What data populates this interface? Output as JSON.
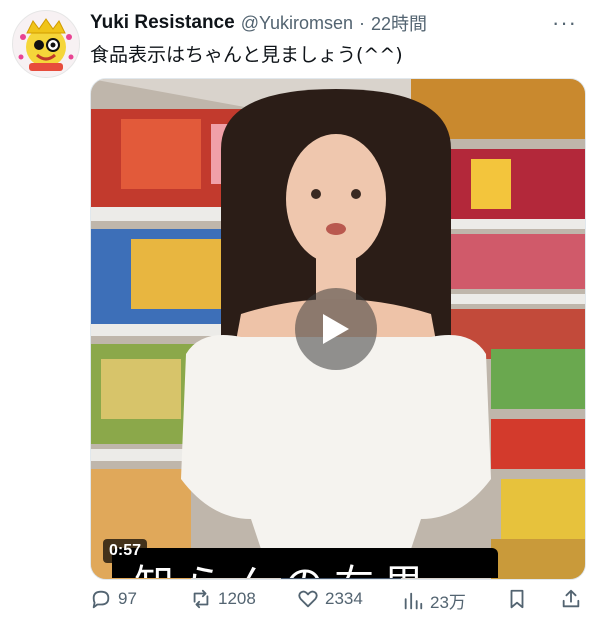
{
  "tweet": {
    "author_name": "Yuki Resistance",
    "handle": "@Yukiromsen",
    "separator": "·",
    "time": "22時間",
    "more_label": "···",
    "text": "食品表示はちゃんと見ましょう(^^)"
  },
  "video": {
    "duration": "0:57",
    "caption": "知らんの右思"
  },
  "actions": {
    "replies": "97",
    "retweets": "1208",
    "likes": "2334",
    "views": "23万"
  }
}
